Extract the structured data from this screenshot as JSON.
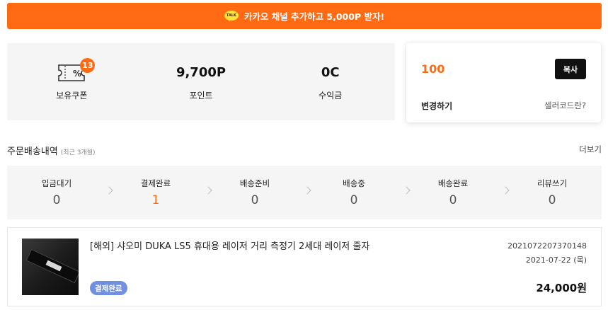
{
  "banner": {
    "icon": "kakaotalk-icon",
    "icon_text": "TALK",
    "text": "카카오 채널 추가하고 5,000P 받자!"
  },
  "stats": [
    {
      "value": "",
      "label": "보유쿠폰",
      "icon": "coupon-icon",
      "badge": "13"
    },
    {
      "value": "9,700P",
      "label": "포인트"
    },
    {
      "value": "0C",
      "label": "수익금"
    }
  ],
  "seller": {
    "code": "100",
    "copy_label": "복사",
    "change_label": "변경하기",
    "help_label": "셀러코드란?"
  },
  "orders_section": {
    "title": "주문배송내역",
    "subtitle": "(최근 3개월)",
    "more_label": "더보기"
  },
  "statuses": [
    {
      "label": "입금대기",
      "count": "0"
    },
    {
      "label": "결제완료",
      "count": "1"
    },
    {
      "label": "배송준비",
      "count": "0"
    },
    {
      "label": "배송중",
      "count": "0"
    },
    {
      "label": "배송완료",
      "count": "0"
    },
    {
      "label": "리뷰쓰기",
      "count": "0"
    }
  ],
  "order": {
    "product_name": "[해외] 샤오미 DUKA LS5 휴대용 레이저 거리 측정기 2세대 레이저 줄자",
    "status_badge": "결제완료",
    "order_number": "2021072207370148",
    "order_date": "2021-07-22 (목)",
    "price": "24,000원"
  },
  "colors": {
    "accent": "#ff6a13",
    "badge_blue": "#6f8fe0",
    "panel_bg": "#f5f5f5"
  }
}
